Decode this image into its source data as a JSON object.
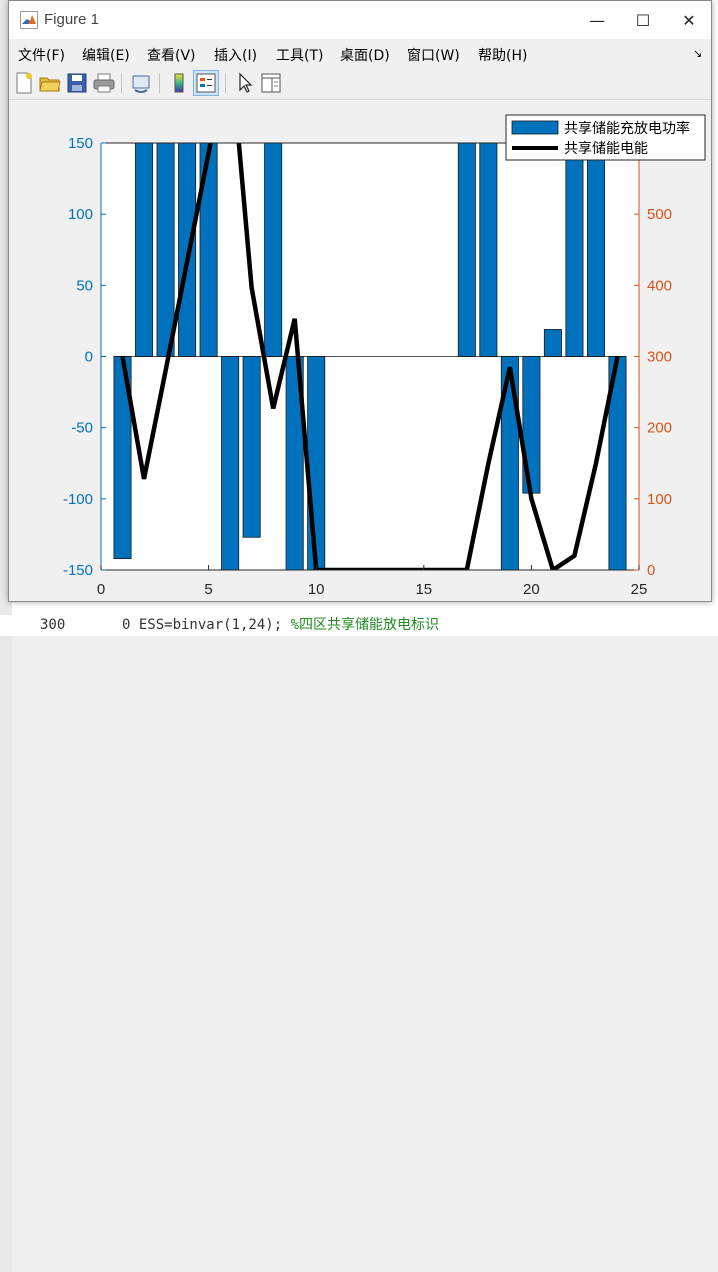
{
  "window": {
    "title": "Figure 1",
    "minimize_glyph": "—",
    "maximize_glyph": "☐",
    "close_glyph": "✕"
  },
  "menu": [
    "文件(F)",
    "编辑(E)",
    "查看(V)",
    "插入(I)",
    "工具(T)",
    "桌面(D)",
    "窗口(W)",
    "帮助(H)"
  ],
  "menu_overflow_glyph": "↘",
  "toolbar": {
    "icons": [
      "new-figure-icon",
      "open-file-icon",
      "save-icon",
      "print-icon",
      "link-plot-icon",
      "insert-colorbar-icon",
      "insert-legend-icon",
      "edit-plot-arrow-icon",
      "property-inspector-icon"
    ]
  },
  "background": {
    "line_number": "300",
    "code_prefix": "0 ESS=binvar(1,24);",
    "code_comment": "%四区共享储能放电标识"
  },
  "colors": {
    "bar": "#0072BD",
    "left_axis": "#0072BD",
    "right_axis": "#D95319",
    "line": "#000000",
    "plot_bg": "#ffffff",
    "window_bg": "#f0f0f0"
  },
  "chart_data": {
    "type": "bar",
    "title": "",
    "xlabel": "",
    "ylabel": "",
    "x": [
      1,
      2,
      3,
      4,
      5,
      6,
      7,
      8,
      9,
      10,
      11,
      12,
      13,
      14,
      15,
      16,
      17,
      18,
      19,
      20,
      21,
      22,
      23,
      24
    ],
    "xlim": [
      0,
      25
    ],
    "xticks": [
      0,
      5,
      10,
      15,
      20,
      25
    ],
    "left_axis": {
      "ylim": [
        -150,
        150
      ],
      "ticks": [
        -150,
        -100,
        -50,
        0,
        50,
        100,
        150
      ]
    },
    "right_axis": {
      "ylim": [
        0,
        600
      ],
      "ticks": [
        0,
        100,
        200,
        300,
        400,
        500
      ]
    },
    "series": [
      {
        "name": "共享储能充放电功率",
        "type": "bar",
        "axis": "left",
        "values": [
          -142,
          150,
          150,
          150,
          150,
          -150,
          -127,
          150,
          -150,
          -150,
          0,
          0,
          0,
          0,
          0,
          0,
          150,
          150,
          -150,
          -96,
          19,
          150,
          150,
          -150
        ]
      },
      {
        "name": "共享储能电能",
        "type": "line",
        "axis": "right",
        "values": [
          300,
          128,
          280,
          433,
          586,
          739,
          397,
          227,
          353,
          0,
          0,
          0,
          0,
          0,
          0,
          0,
          0,
          150,
          285,
          100,
          0,
          20,
          150,
          300
        ]
      }
    ],
    "legend_position": "top-right",
    "grid": false
  }
}
